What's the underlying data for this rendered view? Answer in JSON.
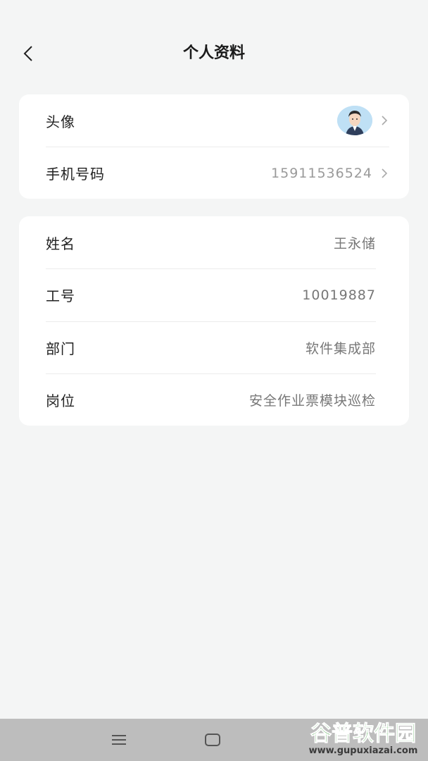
{
  "header": {
    "title": "个人资料"
  },
  "profile_card": {
    "avatar_label": "头像",
    "phone_label": "手机号码",
    "phone_value": "15911536524"
  },
  "info_card": {
    "rows": [
      {
        "label": "姓名",
        "value": "王永储"
      },
      {
        "label": "工号",
        "value": "10019887"
      },
      {
        "label": "部门",
        "value": "软件集成部"
      },
      {
        "label": "岗位",
        "value": "安全作业票模块巡检"
      }
    ]
  },
  "watermark": {
    "brand": "谷普软件园",
    "url": "www.gupuxiazai.com"
  },
  "icons": {
    "back": "chevron-left-icon",
    "avatar": "avatar-image",
    "nav_menu": "menu-icon",
    "nav_home": "home-square-icon"
  },
  "colors": {
    "background": "#f4f5f5",
    "card": "#ffffff",
    "navbar": "#bdbdbd",
    "watermark_green": "#2e9a2e"
  }
}
